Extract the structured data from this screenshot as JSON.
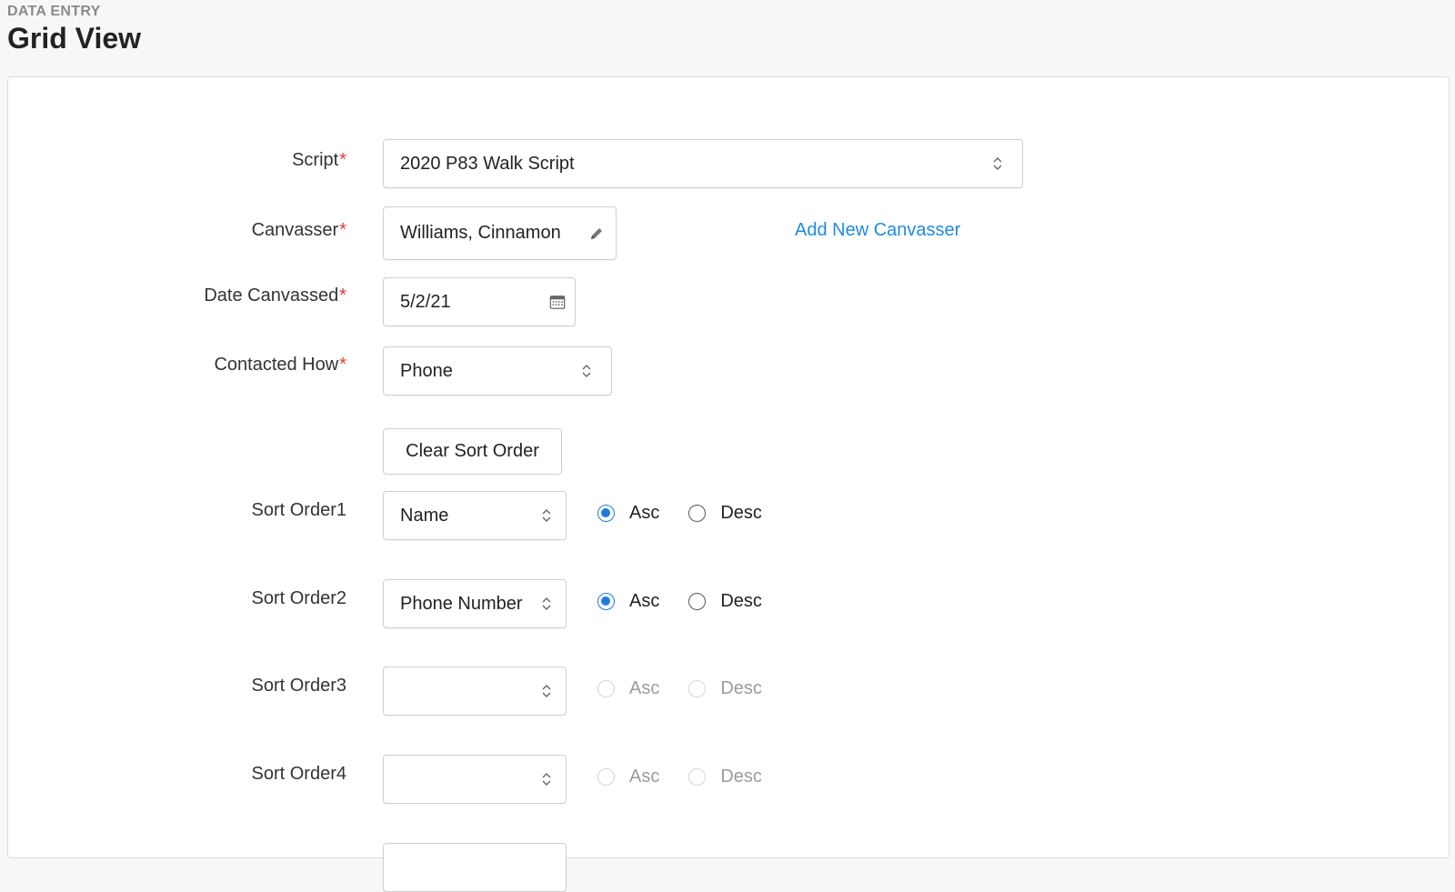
{
  "header": {
    "eyebrow": "DATA ENTRY",
    "title": "Grid View"
  },
  "form": {
    "script": {
      "label": "Script",
      "value": "2020 P83 Walk Script"
    },
    "canvasser": {
      "label": "Canvasser",
      "value": "Williams, Cinnamon",
      "add_link": "Add New Canvasser"
    },
    "date": {
      "label": "Date Canvassed",
      "value": "5/2/21"
    },
    "contacted": {
      "label": "Contacted How",
      "value": "Phone"
    },
    "clear_sort_label": "Clear Sort Order",
    "required_mark": "*"
  },
  "sort_orders": [
    {
      "label": "Sort Order1",
      "value": "Name",
      "asc": "Asc",
      "desc": "Desc",
      "selected": "asc",
      "enabled": true
    },
    {
      "label": "Sort Order2",
      "value": "Phone Number",
      "asc": "Asc",
      "desc": "Desc",
      "selected": "asc",
      "enabled": true
    },
    {
      "label": "Sort Order3",
      "value": "",
      "asc": "Asc",
      "desc": "Desc",
      "selected": "none",
      "enabled": false
    },
    {
      "label": "Sort Order4",
      "value": "",
      "asc": "Asc",
      "desc": "Desc",
      "selected": "none",
      "enabled": false
    }
  ],
  "colors": {
    "accent": "#1f7ae0",
    "link": "#1f8ce0",
    "required": "#e03b3b"
  }
}
